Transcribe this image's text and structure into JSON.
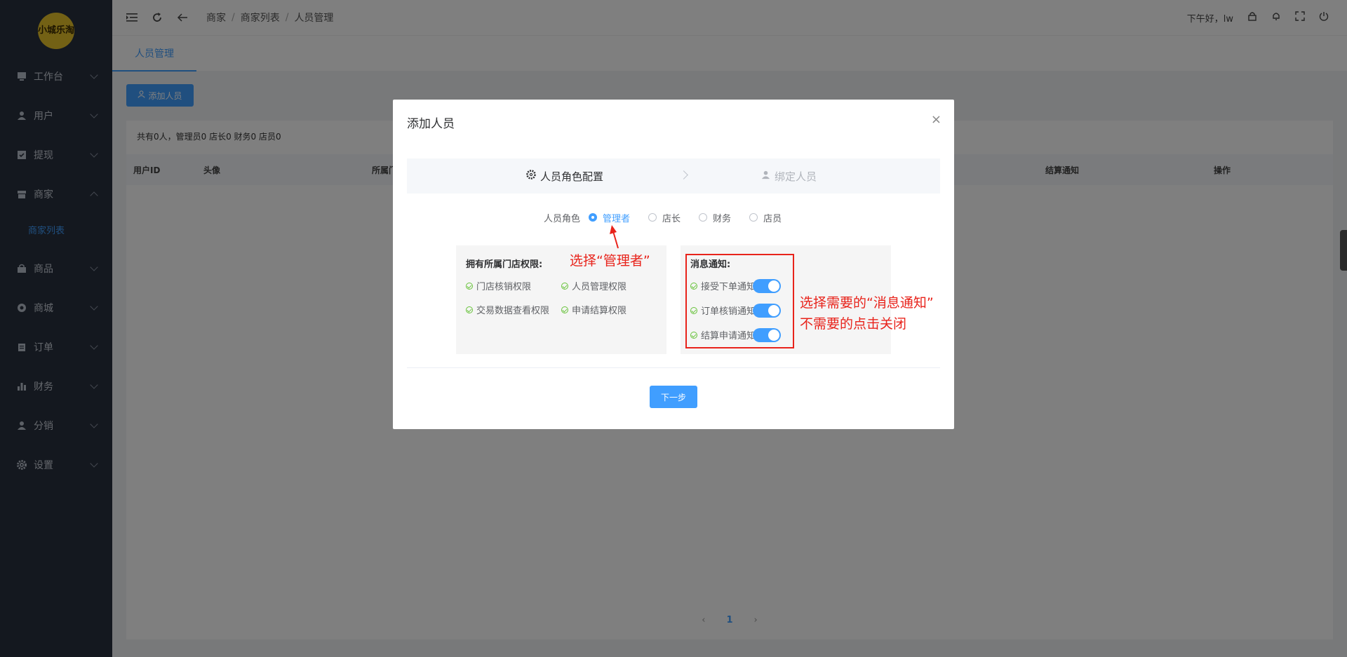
{
  "sidebar": {
    "logo_text": "小城乐淘",
    "items": [
      {
        "label": "工作台",
        "icon": "monitor-icon"
      },
      {
        "label": "用户",
        "icon": "user-icon"
      },
      {
        "label": "提现",
        "icon": "checklist-icon"
      },
      {
        "label": "商家",
        "icon": "store-icon"
      },
      {
        "label": "商品",
        "icon": "bag-icon"
      },
      {
        "label": "商城",
        "icon": "mall-icon"
      },
      {
        "label": "订单",
        "icon": "clipboard-icon"
      },
      {
        "label": "财务",
        "icon": "bar-chart-icon"
      },
      {
        "label": "分销",
        "icon": "people-icon"
      },
      {
        "label": "设置",
        "icon": "gear-icon"
      }
    ],
    "sub_item": "商家列表"
  },
  "topbar": {
    "breadcrumb": [
      "商家",
      "商家列表",
      "人员管理"
    ],
    "greeting": "下午好，lw"
  },
  "tab": {
    "label": "人员管理"
  },
  "page": {
    "add_button": "添加人员",
    "summary": "共有0人，管理员0 店长0 财务0 店员0",
    "columns": [
      "用户ID",
      "头像",
      "所属门",
      "结算通知",
      "操作"
    ],
    "current_page": "1"
  },
  "modal": {
    "title": "添加人员",
    "close": "×",
    "steps": [
      "人员角色配置",
      "绑定人员"
    ],
    "role_label": "人员角色",
    "roles": [
      "管理者",
      "店长",
      "财务",
      "店员"
    ],
    "selected_role": "管理者",
    "permissions_title": "拥有所属门店权限:",
    "permissions": [
      "门店核销权限",
      "人员管理权限",
      "交易数据查看权限",
      "申请结算权限"
    ],
    "notify_title": "消息通知:",
    "notifications": [
      {
        "label": "接受下单通知",
        "on": true
      },
      {
        "label": "订单核销通知",
        "on": true
      },
      {
        "label": "结算申请通知",
        "on": true
      }
    ],
    "next_button": "下一步"
  },
  "annotations": {
    "select_manager": "选择“管理者”",
    "notify_line1": "选择需要的“消息通知”",
    "notify_line2": "不需要的点击关闭"
  },
  "colors": {
    "primary": "#409eff",
    "sidebar_bg": "#29303e",
    "annotation": "#e8231b"
  }
}
